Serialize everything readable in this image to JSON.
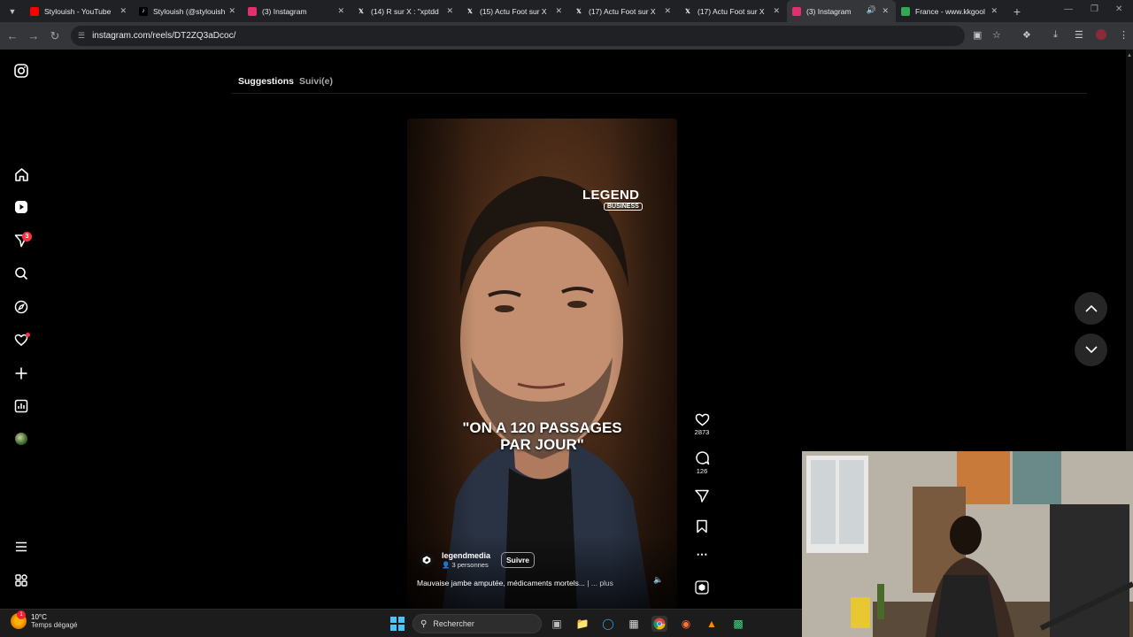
{
  "browser": {
    "tabs": [
      {
        "title": "Stylouish - YouTube",
        "icon": "youtube-icon",
        "color": "#ff0000"
      },
      {
        "title": "Stylouish (@stylouish",
        "icon": "tiktok-icon",
        "color": "#000000"
      },
      {
        "title": "(3) Instagram",
        "icon": "instagram-icon",
        "color": "#e1306c"
      },
      {
        "title": "(14) R sur X : \"xptdd",
        "icon": "x-icon",
        "color": "#000000"
      },
      {
        "title": "(15) Actu Foot sur X",
        "icon": "x-icon",
        "color": "#000000"
      },
      {
        "title": "(17) Actu Foot sur X",
        "icon": "x-icon",
        "color": "#000000"
      },
      {
        "title": "(17) Actu Foot sur X",
        "icon": "x-icon",
        "color": "#000000"
      },
      {
        "title": "(3) Instagram",
        "icon": "instagram-icon",
        "color": "#e1306c",
        "active": true
      },
      {
        "title": "France - www.kkgool",
        "icon": "site-icon",
        "color": "#34a853"
      }
    ],
    "url": "instagram.com/reels/DT2ZQ3aDcoc/"
  },
  "sidebar": {
    "notification_count": "3"
  },
  "feed_tabs": {
    "suggestions": "Suggestions",
    "following": "Suivi(e)"
  },
  "reel": {
    "brand_main": "LEGEND",
    "brand_sub": "BUSINESS",
    "caption_line1": "\"ON A 120 PASSAGES",
    "caption_line2": "PAR JOUR\"",
    "author": "legendmedia",
    "collab": "3 personnes",
    "follow_label": "Suivre",
    "description": "Mauvaise jambe amputée, médicaments mortels...",
    "more_label": "| ... plus",
    "likes": "2873",
    "comments": "126"
  },
  "taskbar": {
    "temperature": "10°C",
    "weather": "Temps dégagé",
    "search_label": "Rechercher",
    "weather_badge": "1"
  },
  "colors": {
    "background": "#000000",
    "badge": "#ff3040",
    "accent_blue": "#4cc2ff"
  }
}
